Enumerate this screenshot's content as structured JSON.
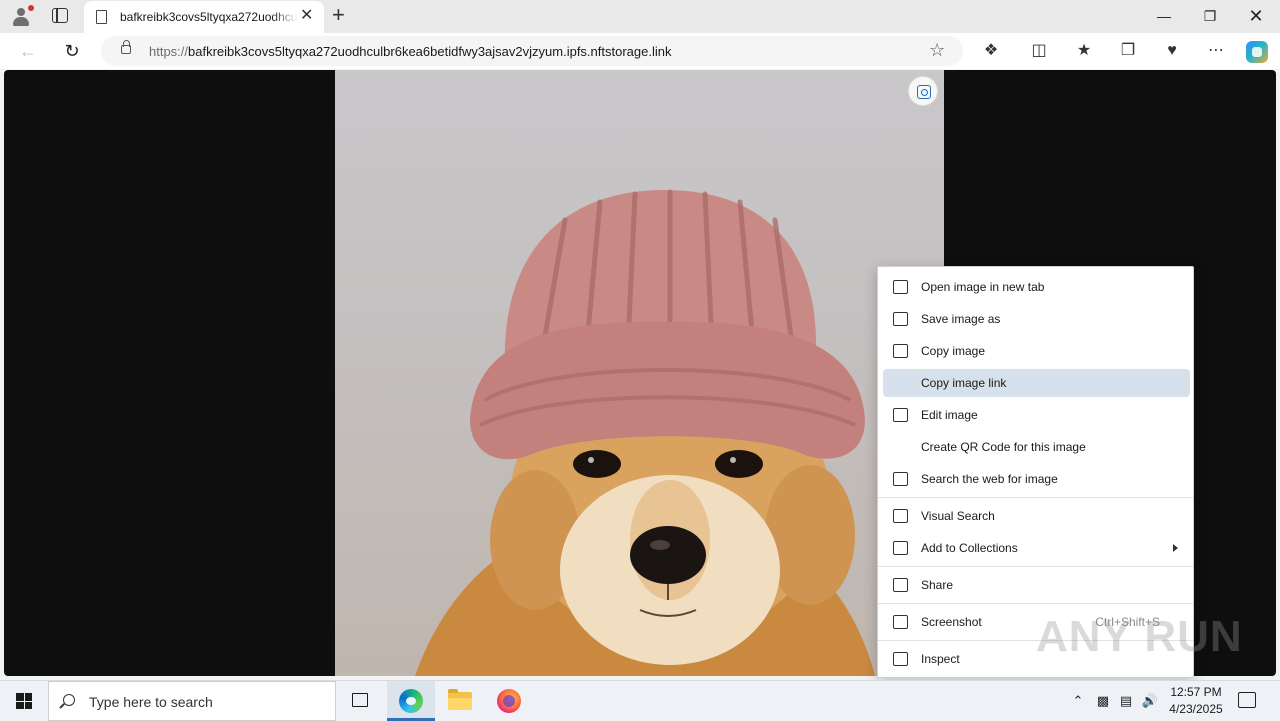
{
  "browser": {
    "tab_title": "bafkreibk3covs5ltyqxa272uodhcu",
    "url_scheme": "https://",
    "url_rest": "bafkreibk3covs5ltyqxa272uodhculbr6kea6betidfwy3ajsav2vjzyum.ipfs.nftstorage.link",
    "new_tab_label": "+",
    "close_tab_label": "✕"
  },
  "window_controls": {
    "minimize": "—",
    "restore": "❐",
    "close": "✕"
  },
  "context_menu": {
    "items": [
      {
        "label": "Open image in new tab",
        "icon": "open-new-tab-icon"
      },
      {
        "label": "Save image as",
        "icon": "save-image-icon"
      },
      {
        "label": "Copy image",
        "icon": "copy-image-icon"
      },
      {
        "label": "Copy image link",
        "icon": "",
        "highlighted": true
      },
      {
        "label": "Edit image",
        "icon": "edit-image-icon"
      },
      {
        "label": "Create QR Code for this image",
        "icon": ""
      },
      {
        "label": "Search the web for image",
        "icon": "search-web-icon"
      },
      {
        "label": "Visual Search",
        "icon": "visual-search-icon"
      },
      {
        "label": "Add to Collections",
        "icon": "collections-icon",
        "submenu": true
      },
      {
        "label": "Share",
        "icon": "share-icon"
      },
      {
        "label": "Screenshot",
        "icon": "screenshot-icon",
        "shortcut": "Ctrl+Shift+S"
      },
      {
        "label": "Inspect",
        "icon": "inspect-icon"
      }
    ]
  },
  "watermark": "ANY RUN",
  "taskbar": {
    "search_placeholder": "Type here to search",
    "time": "12:57 PM",
    "date": "4/23/2025"
  },
  "colors": {
    "menu_highlight": "#d7e1ec",
    "viewport_bg": "#0e0e0e",
    "hat_pink": "#c98a86",
    "dog_fur": "#d9a25e"
  }
}
